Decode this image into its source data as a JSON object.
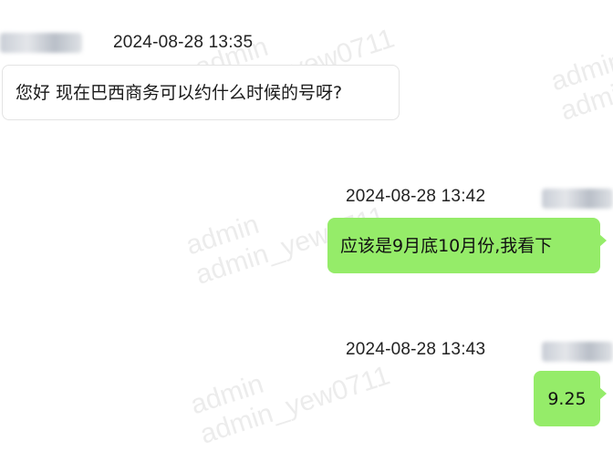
{
  "watermark": [
    "admin",
    "admin_yew0711"
  ],
  "messages": [
    {
      "direction": "incoming",
      "timestamp": "2024-08-28 13:35",
      "text": "您好 现在巴西商务可以约什么时候的号呀?"
    },
    {
      "direction": "outgoing",
      "timestamp": "2024-08-28 13:42",
      "text": "应该是9月底10月份,我看下"
    },
    {
      "direction": "outgoing",
      "timestamp": "2024-08-28 13:43",
      "text": "9.25"
    }
  ],
  "colors": {
    "outgoing_bubble": "#95ec69",
    "incoming_bubble": "#ffffff",
    "incoming_border": "#e3e3e3"
  }
}
